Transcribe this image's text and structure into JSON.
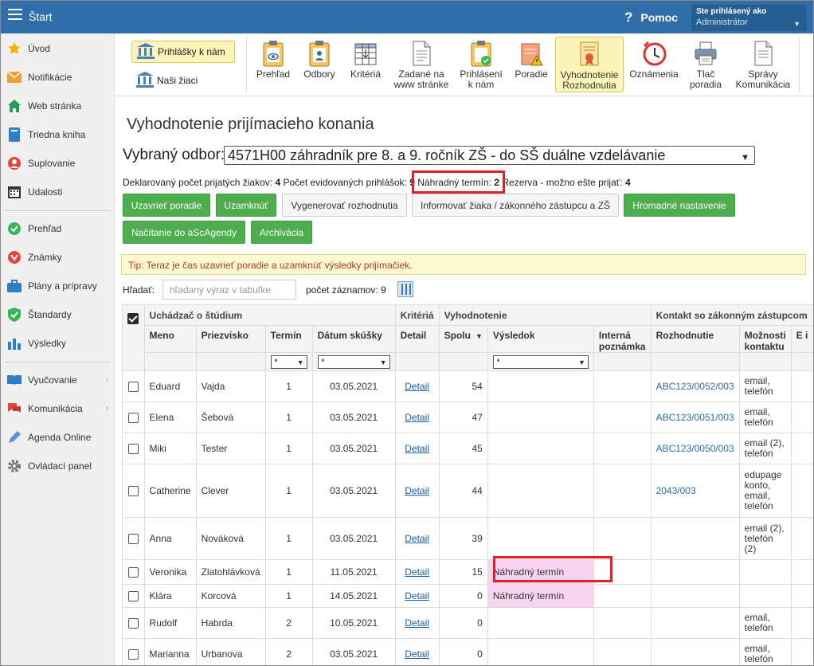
{
  "topbar": {
    "start_label": "Štart",
    "help_label": "Pomoc",
    "user_line1": "Ste prihlásený ako",
    "user_line2": "Administrátor"
  },
  "sidebar": {
    "items": [
      {
        "label": "Úvod",
        "icon": "star-icon"
      },
      {
        "label": "Notifikácie",
        "icon": "envelope-icon"
      },
      {
        "label": "Web stránka",
        "icon": "house-icon"
      },
      {
        "label": "Triedna kniha",
        "icon": "book-icon"
      },
      {
        "label": "Suplovanie",
        "icon": "person-icon"
      },
      {
        "label": "Udalosti",
        "icon": "calendar-icon"
      },
      {
        "label": "Prehľad",
        "icon": "check-circle-icon"
      },
      {
        "label": "Známky",
        "icon": "grade-icon"
      },
      {
        "label": "Plány a prípravy",
        "icon": "briefcase-icon"
      },
      {
        "label": "Štandardy",
        "icon": "shield-icon"
      },
      {
        "label": "Výsledky",
        "icon": "bar-chart-icon"
      },
      {
        "label": "Vyučovanie",
        "icon": "open-book-icon"
      },
      {
        "label": "Komunikácia",
        "icon": "chat-icon"
      },
      {
        "label": "Agenda Online",
        "icon": "pen-icon"
      },
      {
        "label": "Ovládací panel",
        "icon": "gear-icon"
      }
    ]
  },
  "toolbar": {
    "prihlasky": "Prihlášky k nám",
    "nasi_ziaci": "Naši žiaci",
    "buttons": [
      {
        "label": "Prehľad",
        "icon": "clipboard-eye-icon"
      },
      {
        "label": "Odbory",
        "icon": "clipboard-person-icon"
      },
      {
        "label": "Kritériá",
        "icon": "table-icon"
      },
      {
        "label": "Zadané na www stránke",
        "icon": "document-icon"
      },
      {
        "label": "Prihlásení k nám",
        "icon": "clipboard-check-icon"
      },
      {
        "label": "Poradie",
        "icon": "warning-doc-icon"
      },
      {
        "label": "Vyhodnotenie Rozhodnutia",
        "icon": "certificate-icon"
      },
      {
        "label": "Oznámenia",
        "icon": "clock-icon"
      },
      {
        "label": "Tlač poradia",
        "icon": "printer-icon"
      },
      {
        "label": "Správy Komunikácia",
        "icon": "message-doc-icon"
      }
    ]
  },
  "page": {
    "title": "Vyhodnotenie prijímacieho konania",
    "odbor_label": "Vybraný odbor:",
    "odbor_value": "4571H00 záhradník pre 8. a 9. ročník ZŠ - do SŠ duálne vzdelávanie",
    "stats": {
      "deklarovany_label": "Deklarovaný počet prijatých žiakov:",
      "deklarovany": "4",
      "evidovanych_label": "Počet evidovaných prihlášok:",
      "evidovanych": "9",
      "nahradny_label": "Náhradný termín:",
      "nahradny": "2",
      "rezerva_label": "Rezerva - možno ešte prijať:",
      "rezerva": "4"
    },
    "buttons": {
      "uzavriet": "Uzavrieť poradie",
      "uzamknut": "Uzamknúť",
      "vygenerovat": "Vygenerovať rozhodnutia",
      "informovat": "Informovať žiaka / zákonného zástupcu a ZŠ",
      "hromadne": "Hromadné nastavenie",
      "nacitanie": "Načítanie do aScAgendy",
      "archivacia": "Archivácia"
    },
    "tip": "Tip: Teraz je čas uzavrieť poradie a uzamknúť výsledky prijímačiek.",
    "search_label": "Hľadať:",
    "search_placeholder": "hľadaný výraz v tabuľke",
    "record_count_label": "počet záznamov:",
    "record_count": "9"
  },
  "table": {
    "groups": {
      "uchadzac": "Uchádzač o štúdium",
      "kriteria": "Kritériá",
      "vyhodnotenie": "Vyhodnotenie",
      "kontakt": "Kontakt so zákonným zástupcom"
    },
    "headers": {
      "meno": "Meno",
      "priezvisko": "Priezvisko",
      "termin": "Termín",
      "datum": "Dátum skúšky",
      "detail": "Detail",
      "spolu": "Spolu",
      "vysledok": "Výsledok",
      "interna": "Interná poznámka",
      "rozhodnutie": "Rozhodnutie",
      "moznosti": "Možnosti kontaktu",
      "extra": "E i"
    },
    "filters": {
      "termin": "*",
      "datum": "*",
      "vysledok": "*"
    },
    "rows": [
      {
        "meno": "Eduard",
        "priezvisko": "Vajda",
        "termin": "1",
        "datum": "03.05.2021",
        "detail": "Detail",
        "spolu": "54",
        "vysledok": "",
        "rozhodnutie": "ABC123/0052/003",
        "kontakt": "email, telefón"
      },
      {
        "meno": "Elena",
        "priezvisko": "Šebová",
        "termin": "1",
        "datum": "03.05.2021",
        "detail": "Detail",
        "spolu": "47",
        "vysledok": "",
        "rozhodnutie": "ABC123/0051/003",
        "kontakt": "email, telefón"
      },
      {
        "meno": "Miki",
        "priezvisko": "Tester",
        "termin": "1",
        "datum": "03.05.2021",
        "detail": "Detail",
        "spolu": "45",
        "vysledok": "",
        "rozhodnutie": "ABC123/0050/003",
        "kontakt": "email (2), telefón"
      },
      {
        "meno": "Catherine",
        "priezvisko": "Clever",
        "termin": "1",
        "datum": "03.05.2021",
        "detail": "Detail",
        "spolu": "44",
        "vysledok": "",
        "rozhodnutie": "2043/003",
        "kontakt": "edupage konto, email, telefón"
      },
      {
        "meno": "Anna",
        "priezvisko": "Nováková",
        "termin": "1",
        "datum": "03.05.2021",
        "detail": "Detail",
        "spolu": "39",
        "vysledok": "",
        "rozhodnutie": "",
        "kontakt": "email (2), telefón (2)"
      },
      {
        "meno": "Veronika",
        "priezvisko": "Zlatohlávková",
        "termin": "1",
        "datum": "11.05.2021",
        "detail": "Detail",
        "spolu": "15",
        "vysledok": "Náhradný termín",
        "rozhodnutie": "",
        "kontakt": ""
      },
      {
        "meno": "Klára",
        "priezvisko": "Korcová",
        "termin": "1",
        "datum": "14.05.2021",
        "detail": "Detail",
        "spolu": "0",
        "vysledok": "Náhradný termín",
        "rozhodnutie": "",
        "kontakt": ""
      },
      {
        "meno": "Rudolf",
        "priezvisko": "Habrda",
        "termin": "2",
        "datum": "10.05.2021",
        "detail": "Detail",
        "spolu": "0",
        "vysledok": "",
        "rozhodnutie": "",
        "kontakt": "email, telefón"
      },
      {
        "meno": "Marianna",
        "priezvisko": "Urbanova",
        "termin": "2",
        "datum": "03.05.2021",
        "detail": "Detail",
        "spolu": "0",
        "vysledok": "",
        "rozhodnutie": "",
        "kontakt": "email, telefón"
      }
    ]
  },
  "colors": {
    "topbar": "#2f6ea8",
    "green_button": "#4cae4c",
    "highlight": "#e2202a",
    "pink_cell": "#f9d4f1",
    "selected_tool": "#fdf4b8"
  }
}
